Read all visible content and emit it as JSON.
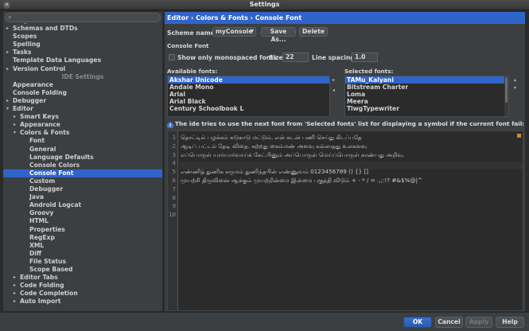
{
  "window": {
    "title": "Settings"
  },
  "search": {
    "placeholder": ""
  },
  "sidebar": {
    "rows": [
      {
        "label": "Plugins",
        "indent": 0,
        "arrow": "",
        "partial": true
      },
      {
        "label": "Schemas and DTDs",
        "indent": 0,
        "arrow": "right"
      },
      {
        "label": "Scopes",
        "indent": 0,
        "arrow": ""
      },
      {
        "label": "Spelling",
        "indent": 0,
        "arrow": ""
      },
      {
        "label": "Tasks",
        "indent": 0,
        "arrow": "right"
      },
      {
        "label": "Template Data Languages",
        "indent": 0,
        "arrow": ""
      },
      {
        "label": "Version Control",
        "indent": 0,
        "arrow": "right"
      },
      {
        "label": "IDE Settings",
        "section": true
      },
      {
        "label": "Appearance",
        "indent": 0,
        "arrow": ""
      },
      {
        "label": "Console Folding",
        "indent": 0,
        "arrow": ""
      },
      {
        "label": "Debugger",
        "indent": 0,
        "arrow": "right"
      },
      {
        "label": "Editor",
        "indent": 0,
        "arrow": "down"
      },
      {
        "label": "Smart Keys",
        "indent": 1,
        "arrow": "right"
      },
      {
        "label": "Appearance",
        "indent": 1,
        "arrow": "right"
      },
      {
        "label": "Colors & Fonts",
        "indent": 1,
        "arrow": "down"
      },
      {
        "label": "Font",
        "indent": 2,
        "arrow": ""
      },
      {
        "label": "General",
        "indent": 2,
        "arrow": ""
      },
      {
        "label": "Language Defaults",
        "indent": 2,
        "arrow": ""
      },
      {
        "label": "Console Colors",
        "indent": 2,
        "arrow": ""
      },
      {
        "label": "Console Font",
        "indent": 2,
        "arrow": "",
        "selected": true
      },
      {
        "label": "Custom",
        "indent": 2,
        "arrow": ""
      },
      {
        "label": "Debugger",
        "indent": 2,
        "arrow": ""
      },
      {
        "label": "Java",
        "indent": 2,
        "arrow": ""
      },
      {
        "label": "Android Logcat",
        "indent": 2,
        "arrow": ""
      },
      {
        "label": "Groovy",
        "indent": 2,
        "arrow": ""
      },
      {
        "label": "HTML",
        "indent": 2,
        "arrow": ""
      },
      {
        "label": "Properties",
        "indent": 2,
        "arrow": ""
      },
      {
        "label": "RegExp",
        "indent": 2,
        "arrow": ""
      },
      {
        "label": "XML",
        "indent": 2,
        "arrow": ""
      },
      {
        "label": "Diff",
        "indent": 2,
        "arrow": ""
      },
      {
        "label": "File Status",
        "indent": 2,
        "arrow": ""
      },
      {
        "label": "Scope Based",
        "indent": 2,
        "arrow": ""
      },
      {
        "label": "Editor Tabs",
        "indent": 1,
        "arrow": "right"
      },
      {
        "label": "Code Folding",
        "indent": 1,
        "arrow": "right"
      },
      {
        "label": "Code Completion",
        "indent": 1,
        "arrow": "right"
      },
      {
        "label": "Auto Import",
        "indent": 1,
        "arrow": "right"
      }
    ]
  },
  "breadcrumb": "Editor › Colors & Fonts › Console Font",
  "scheme": {
    "label": "Scheme name:",
    "value": "myConsole",
    "save_as": "Save As...",
    "delete": "Delete"
  },
  "console_font": {
    "section_title": "Console Font",
    "monospaced_label": "Show only monospaced fonts",
    "size_label": "Size:",
    "size_value": "22",
    "spacing_label": "Line spacing:",
    "spacing_value": "1.0"
  },
  "available_fonts": {
    "label": "Available fonts:",
    "items": [
      "Akshar Unicode",
      "Andale Mono",
      "Arial",
      "Arial Black",
      "Century Schoolbook L"
    ],
    "selected_index": 0
  },
  "selected_fonts": {
    "label": "Selected fonts:",
    "items": [
      "TAMu_Kalyani",
      "Bitstream Charter",
      "Loma",
      "Meera",
      "TlwgTypewriter"
    ],
    "selected_index": 0
  },
  "info_text": "The ide tries to use the next font from 'Selected fonts' list for displaying a symbol if the current font fails to do th...",
  "preview": {
    "line_numbers": [
      "1",
      "2",
      "3",
      "4",
      "5",
      "6",
      "7",
      "8",
      "9",
      "10"
    ],
    "lines": [
      "தொட்டில் பழக்கம் சுடுகாடு மட்டும். என் கடன் பணி செய்து கிடப்பதே",
      "ஆடிப் பட்டம் தேடி விதை. கற்றது கைம்மண் அளவு கல்லாதது உலகளவு",
      "எப்பொருள் யார்யார்வாய்க் கேட்பினும் அப்பொருள் மெய்ப்பொருள் காண்பது அறிவு.",
      "",
      "எண்ணித் துணிக கருமம் துணிந்தபின் எண்ணுவம் 0123456789 () {} []",
      "முயற்சி திருவினை ஆக்கும் முயற்றின்மை இன்மை புகுத்தி விடும் + - * / = .,;:!? #&$%@|^",
      "",
      "",
      "",
      ""
    ]
  },
  "buttons": {
    "ok": "OK",
    "cancel": "Cancel",
    "apply": "Apply",
    "help": "Help"
  }
}
